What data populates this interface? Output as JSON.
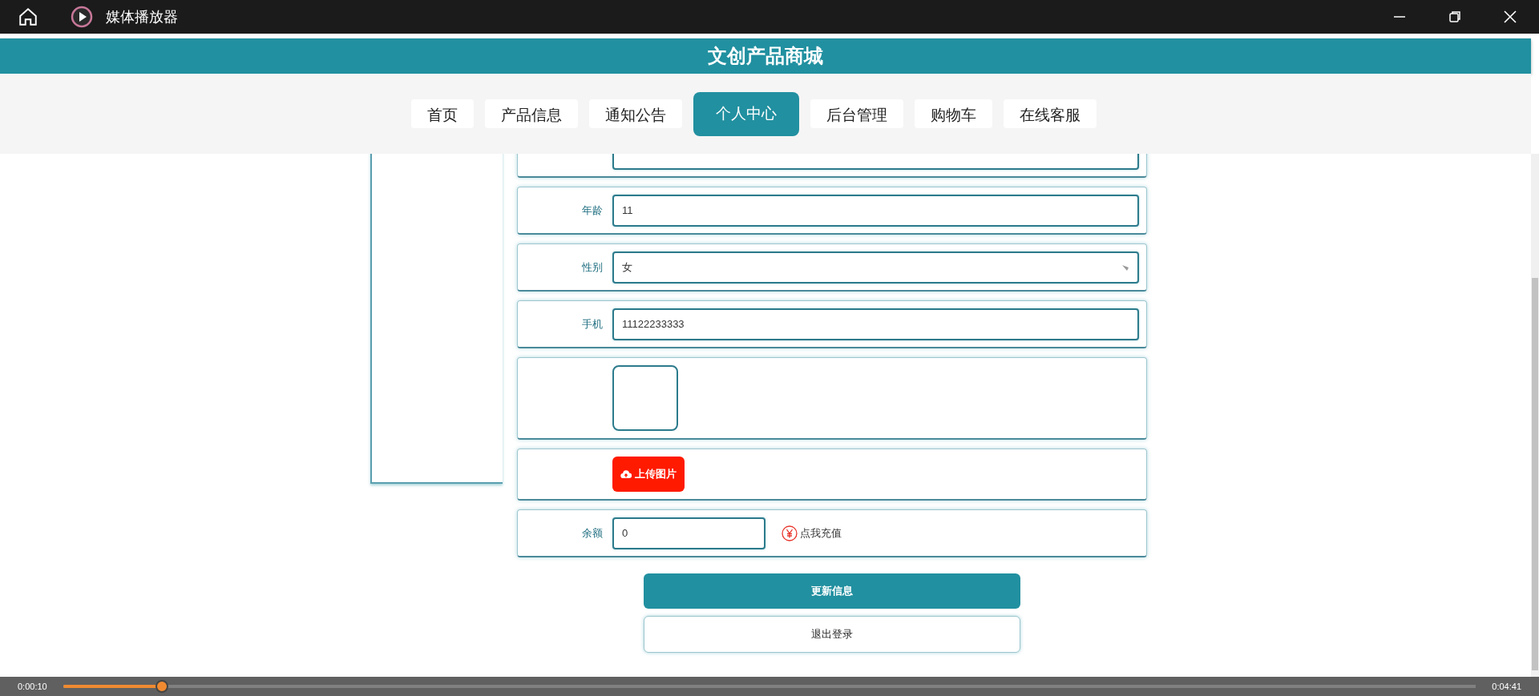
{
  "window": {
    "title": "媒体播放器"
  },
  "site": {
    "title": "文创产品商城"
  },
  "nav": [
    {
      "label": "首页",
      "selected": false
    },
    {
      "label": "产品信息",
      "selected": false
    },
    {
      "label": "通知公告",
      "selected": false
    },
    {
      "label": "个人中心",
      "selected": true
    },
    {
      "label": "后台管理",
      "selected": false
    },
    {
      "label": "购物车",
      "selected": false
    },
    {
      "label": "在线客服",
      "selected": false
    }
  ],
  "form": {
    "rows": [
      {
        "kind": "text"
      },
      {
        "kind": "text",
        "label": "年龄",
        "value": "11"
      },
      {
        "kind": "select",
        "label": "性别",
        "value": "女"
      },
      {
        "kind": "text",
        "label": "手机",
        "value": "11122233333"
      },
      {
        "kind": "image"
      },
      {
        "kind": "upload",
        "button": "上传图片"
      },
      {
        "kind": "balance",
        "label": "余额",
        "value": "0",
        "link": "点我充值"
      }
    ]
  },
  "buttons": [
    {
      "kind": "primary",
      "label": "更新信息"
    },
    {
      "kind": "secondary",
      "label": "退出登录"
    }
  ],
  "player": {
    "elapsed": "0:00:10",
    "total": "0:04:41",
    "level": 0.07
  }
}
